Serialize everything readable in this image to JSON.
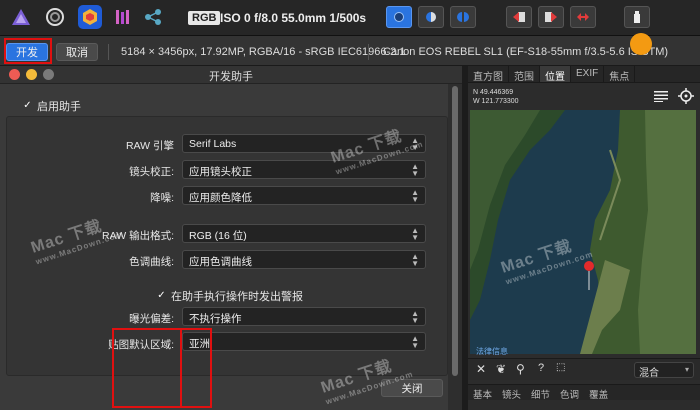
{
  "toolbar": {
    "rgb_badge": "RGB",
    "exif_readout": "ISO 0 f/8.0 55.0mm 1/500s"
  },
  "contextbar": {
    "develop_label": "开发",
    "cancel_label": "取消",
    "image_info": "5184 × 3456px, 17.92MP, RGBA/16 - sRGB IEC61966-2.1",
    "camera_info": "Canon EOS REBEL SL1 (EF-S18-55mm f/3.5-5.6 IS STM)"
  },
  "dialog": {
    "title": "开发助手",
    "enable_assistant": "启用助手",
    "raw_engine_label": "RAW 引擎",
    "raw_engine_value": "Serif Labs",
    "lens_correction_label": "镜头校正:",
    "lens_correction_value": "应用镜头校正",
    "noise_label": "降噪:",
    "noise_value": "应用颜色降低",
    "raw_output_label": "RAW 输出格式:",
    "raw_output_value": "RGB (16 位)",
    "tone_curve_label": "色调曲线:",
    "tone_curve_value": "应用色调曲线",
    "warn_label": "在助手执行操作时发出警报",
    "exposure_label": "曝光偏差:",
    "exposure_value": "不执行操作",
    "map_region_label": "贴图默认区域:",
    "map_region_value": "亚洲",
    "close_label": "关闭"
  },
  "panel": {
    "tabs": [
      "直方图",
      "范围",
      "位置",
      "EXIF",
      "焦点"
    ],
    "lat": "N 49.446369",
    "lon": "W 121.773300",
    "map_link": "法律信息",
    "blend_value": "混合",
    "bottom_tabs": [
      "基本",
      "镜头",
      "细节",
      "色调",
      "覆盖"
    ]
  },
  "watermarks": [
    "Mac 下载",
    "www.MacDown.com"
  ],
  "colors": {
    "accent_blue": "#2a74e0",
    "highlight_red": "#e01010",
    "marker_orange": "#f39a12",
    "map_pin": "#e32b2b"
  }
}
